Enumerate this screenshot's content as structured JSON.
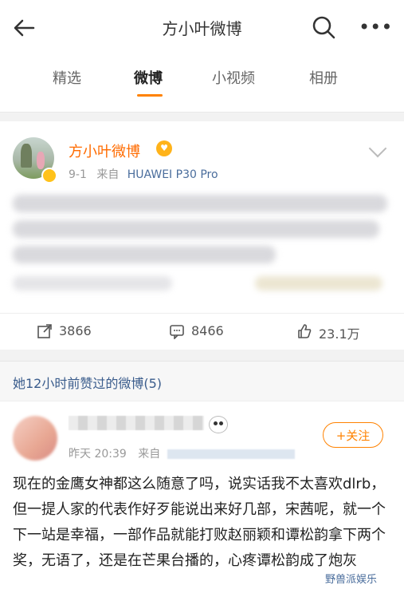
{
  "header": {
    "title": "方小叶微博",
    "back_icon": "back-arrow-icon",
    "search_icon": "search-icon",
    "more_icon": "more-icon"
  },
  "tabs": [
    {
      "label": "精选",
      "active": false
    },
    {
      "label": "微博",
      "active": true
    },
    {
      "label": "小视频",
      "active": false
    },
    {
      "label": "相册",
      "active": false
    }
  ],
  "post_card": {
    "author": "方小叶微博",
    "date": "9-1",
    "source_prefix": "来自",
    "source": "HUAWEI P30 Pro",
    "reposts": "3866",
    "comments": "8466",
    "likes": "23.1万"
  },
  "liked_section": {
    "title": "她12小时前赞过的微博(5)"
  },
  "liked_post": {
    "time": "昨天 20:39",
    "source_prefix": "来自",
    "follow_label": "+关注",
    "body": "现在的金鹰女神都这么随意了吗，说实话我不太喜欢dlrb，但一提人家的代表作好歹能说出来好几部，宋茜呢，就一个下一站是幸福，一部作品就能打败赵丽颖和谭松韵拿下两个奖，无语了，还是在芒果台播的，心疼谭松韵成了炮灰"
  },
  "watermark": "野兽派娱乐",
  "colors": {
    "accent": "#ff8200",
    "username": "#ff6b00",
    "link": "#4a6d9c"
  }
}
